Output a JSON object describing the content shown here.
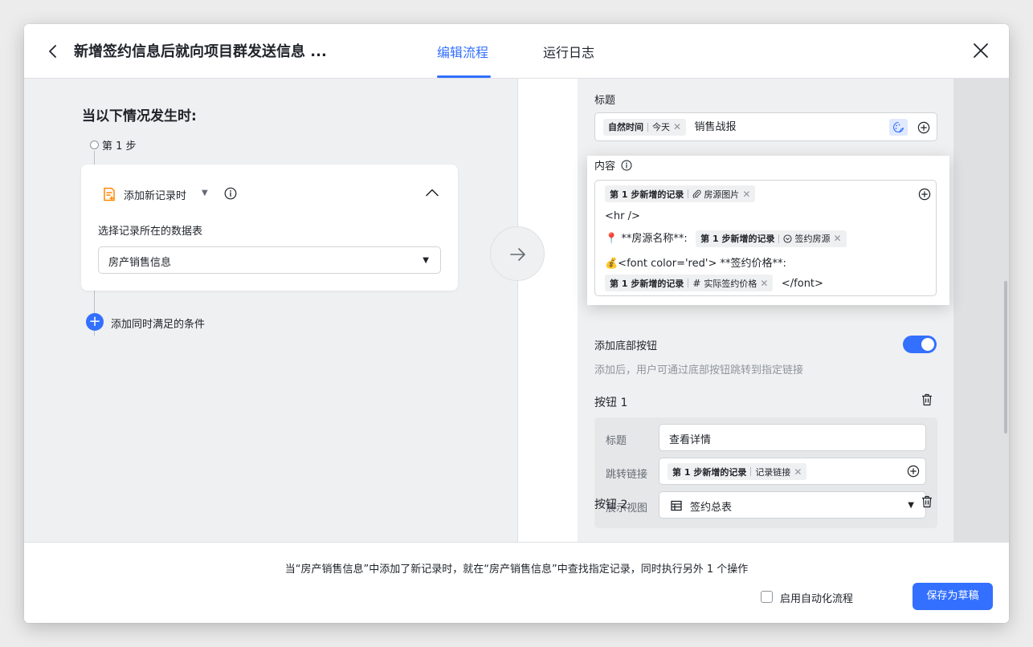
{
  "header": {
    "title": "新增签约信息后就向项目群发送信息 ...",
    "tabs": [
      {
        "label": "编辑流程",
        "active": true
      },
      {
        "label": "运行日志",
        "active": false
      }
    ]
  },
  "trigger": {
    "heading": "当以下情况发生时:",
    "step_label": "第 1 步",
    "card_title": "添加新记录时",
    "table_label": "选择记录所在的数据表",
    "table_value": "房产销售信息",
    "add_condition": "添加同时满足的条件"
  },
  "action": {
    "title_label": "标题",
    "title_tag": {
      "source": "自然时间",
      "field": "今天"
    },
    "title_text": "销售战报",
    "content_label": "内容",
    "content": {
      "line1_tag": {
        "source": "第 1 步新增的记录",
        "field": "房源图片"
      },
      "line2_text": "<hr />",
      "line3_prefix": "📍 **房源名称**:",
      "line3_tag": {
        "source": "第 1 步新增的记录",
        "field": "签约房源"
      },
      "line4_text": "💰<font color='red'> **签约价格**:",
      "line5_tag": {
        "source": "第 1 步新增的记录",
        "field": "实际签约价格"
      },
      "line5_suffix": "</font>"
    },
    "bottom_button_label": "添加底部按钮",
    "bottom_button_enabled": true,
    "bottom_button_hint": "添加后，用户可通过底部按钮跳转到指定链接",
    "button1": {
      "heading": "按钮 1",
      "title_label": "标题",
      "title_value": "查看详情",
      "link_label": "跳转链接",
      "link_tag": {
        "source": "第 1 步新增的记录",
        "field": "记录链接"
      },
      "view_label": "展示视图",
      "view_value": "签约总表"
    },
    "button2": {
      "heading": "按钮 2"
    }
  },
  "footer": {
    "summary": "当“房产销售信息”中添加了新记录时，就在“房产销售信息”中查找指定记录，同时执行另外 1 个操作",
    "enable_label": "启用自动化流程",
    "enable_checked": false,
    "save_label": "保存为草稿"
  },
  "colors": {
    "accent": "#3370ff",
    "text": "#1f2329",
    "muted": "#8f959e"
  }
}
